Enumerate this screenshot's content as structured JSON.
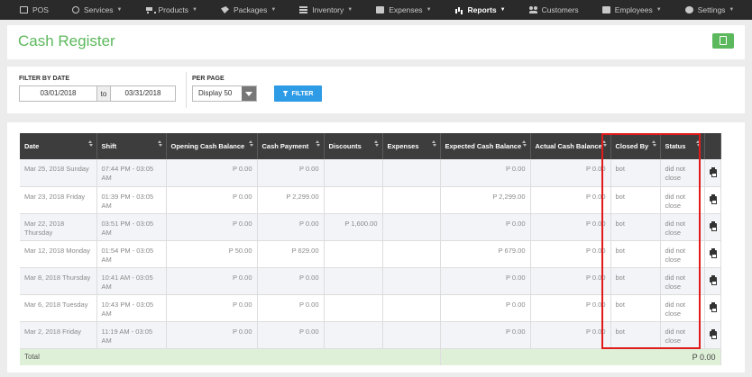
{
  "nav": {
    "items": [
      {
        "label": "POS",
        "icon": "monitor-icon",
        "caret": false
      },
      {
        "label": "Services",
        "icon": "refresh-icon",
        "caret": true
      },
      {
        "label": "Products",
        "icon": "cart-icon",
        "caret": true
      },
      {
        "label": "Packages",
        "icon": "tag-icon",
        "caret": true
      },
      {
        "label": "Inventory",
        "icon": "bars-icon",
        "caret": true
      },
      {
        "label": "Expenses",
        "icon": "money-icon",
        "caret": true
      },
      {
        "label": "Reports",
        "icon": "chart-icon",
        "caret": true,
        "active": true
      },
      {
        "label": "Customers",
        "icon": "users-icon",
        "caret": false
      },
      {
        "label": "Employees",
        "icon": "briefcase-icon",
        "caret": true
      },
      {
        "label": "Settings",
        "icon": "gear-icon",
        "caret": true
      }
    ]
  },
  "header": {
    "title": "Cash Register"
  },
  "filter": {
    "date_label": "FILTER BY DATE",
    "date_from": "03/01/2018",
    "to_label": "to",
    "date_to": "03/31/2018",
    "per_page_label": "PER PAGE",
    "per_page_value": "Display 50",
    "filter_button": "FILTER"
  },
  "table": {
    "columns": [
      "Date",
      "Shift",
      "Opening Cash Balance",
      "Cash Payment",
      "Discounts",
      "Expenses",
      "Expected Cash Balance",
      "Actual Cash Balance",
      "Closed By",
      "Status"
    ],
    "rows": [
      {
        "date": "Mar 25, 2018 Sunday",
        "shift": "07:44 PM - 03:05 AM",
        "opening": "P 0.00",
        "payment": "P 0.00",
        "discounts": "",
        "expenses": "",
        "expected": "P 0.00",
        "actual": "P 0.00",
        "closed_by": "bot",
        "status": "did not close"
      },
      {
        "date": "Mar 23, 2018 Friday",
        "shift": "01:39 PM - 03:05 AM",
        "opening": "P 0.00",
        "payment": "P 2,299.00",
        "discounts": "",
        "expenses": "",
        "expected": "P 2,299.00",
        "actual": "P 0.00",
        "closed_by": "bot",
        "status": "did not close"
      },
      {
        "date": "Mar 22, 2018 Thursday",
        "shift": "03:51 PM - 03:05 AM",
        "opening": "P 0.00",
        "payment": "P 0.00",
        "discounts": "P 1,600.00",
        "expenses": "",
        "expected": "P 0.00",
        "actual": "P 0.00",
        "closed_by": "bot",
        "status": "did not close"
      },
      {
        "date": "Mar 12, 2018 Monday",
        "shift": "01:54 PM - 03:05 AM",
        "opening": "P 50.00",
        "payment": "P 629.00",
        "discounts": "",
        "expenses": "",
        "expected": "P 679.00",
        "actual": "P 0.00",
        "closed_by": "bot",
        "status": "did not close"
      },
      {
        "date": "Mar 8, 2018 Thursday",
        "shift": "10:41 AM - 03:05 AM",
        "opening": "P 0.00",
        "payment": "P 0.00",
        "discounts": "",
        "expenses": "",
        "expected": "P 0.00",
        "actual": "P 0.00",
        "closed_by": "bot",
        "status": "did not close"
      },
      {
        "date": "Mar 6, 2018 Tuesday",
        "shift": "10:43 PM - 03:05 AM",
        "opening": "P 0.00",
        "payment": "P 0.00",
        "discounts": "",
        "expenses": "",
        "expected": "P 0.00",
        "actual": "P 0.00",
        "closed_by": "bot",
        "status": "did not close"
      },
      {
        "date": "Mar 2, 2018 Friday",
        "shift": "11:19 AM - 03:05 AM",
        "opening": "P 0.00",
        "payment": "P 0.00",
        "discounts": "",
        "expenses": "",
        "expected": "P 0.00",
        "actual": "P 0.00",
        "closed_by": "bot",
        "status": "did not close"
      }
    ],
    "footer": {
      "label": "Total",
      "amount": "P 0.00"
    }
  },
  "colors": {
    "accent": "#5cb85c",
    "filter_button": "#2e9be6",
    "nav_bg": "#2a2a2a",
    "highlight": "#e01b1b"
  }
}
